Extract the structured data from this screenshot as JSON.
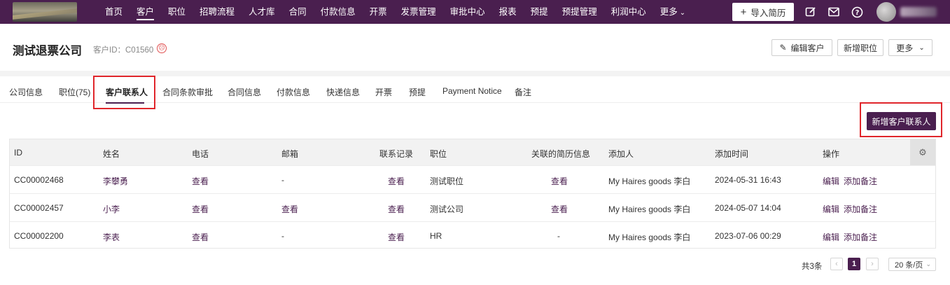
{
  "topbar": {
    "nav": [
      "首页",
      "客户",
      "职位",
      "招聘流程",
      "人才库",
      "合同",
      "付款信息",
      "开票",
      "发票管理",
      "审批中心",
      "报表",
      "预提",
      "预提管理",
      "利润中心"
    ],
    "nav_active": "客户",
    "more_label": "更多",
    "import_label": "导入简历",
    "icons": [
      "edit-square-icon",
      "mail-icon",
      "help-icon"
    ]
  },
  "header": {
    "company_name": "测试退票公司",
    "client_id": "客户ID：C01560",
    "edit_label": "编辑客户",
    "add_job_label": "新增职位",
    "more_label": "更多"
  },
  "tabs": [
    "公司信息",
    "职位(75)",
    "客户联系人",
    "合同条款审批",
    "合同信息",
    "付款信息",
    "快递信息",
    "开票",
    "预提",
    "Payment Notice",
    "备注"
  ],
  "active_tab": "客户联系人",
  "add_contact_label": "新增客户联系人",
  "table": {
    "columns": [
      "ID",
      "姓名",
      "电话",
      "邮箱",
      "联系记录",
      "职位",
      "关联的简历信息",
      "添加人",
      "添加时间",
      "操作"
    ],
    "rows": [
      {
        "id": "CC00002468",
        "name": "李攀勇",
        "phone": "查看",
        "email": "-",
        "record": "查看",
        "position": "测试职位",
        "resume": "查看",
        "added_by": "My Haires goods 李白",
        "time": "2024-05-31 16:43",
        "edit": "编辑",
        "note": "添加备注"
      },
      {
        "id": "CC00002457",
        "name": "小李",
        "phone": "查看",
        "email": "查看",
        "record": "查看",
        "position": "测试公司",
        "resume": "查看",
        "added_by": "My Haires goods 李白",
        "time": "2024-05-07 14:04",
        "edit": "编辑",
        "note": "添加备注"
      },
      {
        "id": "CC00002200",
        "name": "李表",
        "phone": "查看",
        "email": "-",
        "record": "查看",
        "position": "HR",
        "resume": "-",
        "added_by": "My Haires goods 李白",
        "time": "2023-07-06 00:29",
        "edit": "编辑",
        "note": "添加备注"
      }
    ]
  },
  "pagination": {
    "total": "共3条",
    "current_page": "1",
    "page_size": "20 条/页"
  },
  "colors": {
    "brand": "#4a1f4f",
    "highlight": "#e0262b"
  }
}
